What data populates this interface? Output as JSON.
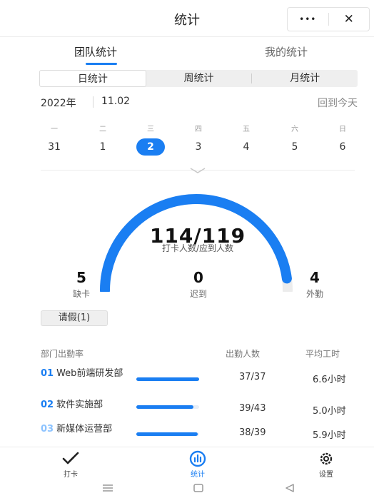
{
  "header": {
    "title": "统计",
    "more_label": "•••",
    "close_label": "✕"
  },
  "tabs": [
    {
      "label": "团队统计",
      "active": true
    },
    {
      "label": "我的统计",
      "active": false
    }
  ],
  "segments": [
    {
      "label": "日统计",
      "active": true
    },
    {
      "label": "周统计",
      "active": false
    },
    {
      "label": "月统计",
      "active": false
    }
  ],
  "date": {
    "year": "2022年",
    "month_day": "11.02",
    "today_label": "回到今天"
  },
  "week": {
    "weekdays": [
      "一",
      "二",
      "三",
      "四",
      "五",
      "六",
      "日"
    ],
    "days": [
      "31",
      "1",
      "2",
      "3",
      "4",
      "5",
      "6"
    ],
    "selected_index": 2
  },
  "gauge": {
    "value_text": "114/119",
    "caption": "打卡人数/应到人数",
    "checked_in": 114,
    "expected": 119
  },
  "stats": [
    {
      "num": "5",
      "label": "缺卡"
    },
    {
      "num": "0",
      "label": "迟到"
    },
    {
      "num": "4",
      "label": "外勤"
    }
  ],
  "leave_label": "请假(1)",
  "table": {
    "headers": [
      "部门出勤率",
      "出勤人数",
      "平均工时"
    ],
    "rows": [
      {
        "idx": "01",
        "name": "Web前端研发部",
        "attendance": "37/37",
        "hours": "6.6小时",
        "rate": 1.0
      },
      {
        "idx": "02",
        "name": "软件实施部",
        "attendance": "39/43",
        "hours": "5.0小时",
        "rate": 0.907
      },
      {
        "idx": "03",
        "name": "新媒体运营部",
        "attendance": "38/39",
        "hours": "5.9小时",
        "rate": 0.974
      }
    ]
  },
  "nav": [
    {
      "label": "打卡",
      "icon": "checkmark-icon",
      "active": false
    },
    {
      "label": "统计",
      "icon": "chart-icon",
      "active": true
    },
    {
      "label": "设置",
      "icon": "gear-icon",
      "active": false
    }
  ],
  "colors": {
    "accent": "#1a7ef2",
    "track": "#e8eef7"
  }
}
